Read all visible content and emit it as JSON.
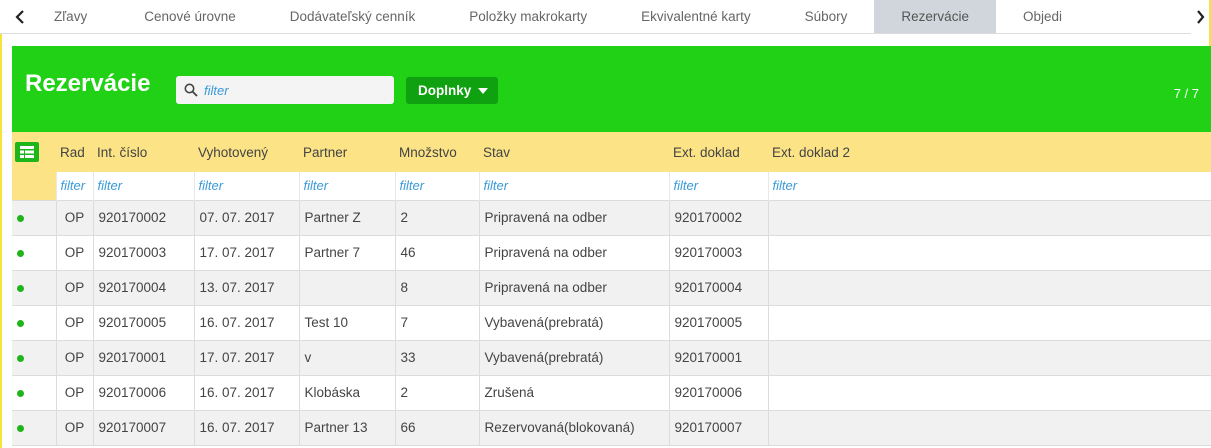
{
  "tabs": [
    {
      "label": "Zľavy",
      "active": false
    },
    {
      "label": "Cenové úrovne",
      "active": false
    },
    {
      "label": "Dodávateľský cenník",
      "active": false
    },
    {
      "label": "Položky makrokarty",
      "active": false
    },
    {
      "label": "Ekvivalentné karty",
      "active": false
    },
    {
      "label": "Súbory",
      "active": false
    },
    {
      "label": "Rezervácie",
      "active": true
    },
    {
      "label": "Objedi",
      "active": false
    }
  ],
  "nav": {
    "prev_icon": "chevron-left-icon",
    "next_icon": "chevron-right-icon"
  },
  "panel": {
    "title": "Rezervácie",
    "search_placeholder": "filter",
    "addons_label": "Doplnky",
    "count": "7 / 7",
    "accent_color": "#21d116",
    "header_color": "#fbe386"
  },
  "columns": [
    "Rad",
    "Int. číslo",
    "Vyhotovený",
    "Partner",
    "Množstvo",
    "Stav",
    "Ext. doklad",
    "Ext. doklad 2"
  ],
  "filter_placeholder": "filter",
  "rows": [
    {
      "rad": "OP",
      "int": "920170002",
      "vyh": "07. 07. 2017",
      "partner": "Partner Z",
      "mnozstvo": "2",
      "stav": "Pripravená na odber",
      "ext": "920170002",
      "ext2": ""
    },
    {
      "rad": "OP",
      "int": "920170003",
      "vyh": "17. 07. 2017",
      "partner": "Partner 7",
      "mnozstvo": "46",
      "stav": "Pripravená na odber",
      "ext": "920170003",
      "ext2": ""
    },
    {
      "rad": "OP",
      "int": "920170004",
      "vyh": "13. 07. 2017",
      "partner": "",
      "mnozstvo": "8",
      "stav": "Pripravená na odber",
      "ext": "920170004",
      "ext2": ""
    },
    {
      "rad": "OP",
      "int": "920170005",
      "vyh": "16. 07. 2017",
      "partner": "Test 10",
      "mnozstvo": "7",
      "stav": "Vybavená(prebratá)",
      "ext": "920170005",
      "ext2": ""
    },
    {
      "rad": "OP",
      "int": "920170001",
      "vyh": "17. 07. 2017",
      "partner": "v",
      "mnozstvo": "33",
      "stav": "Vybavená(prebratá)",
      "ext": "920170001",
      "ext2": ""
    },
    {
      "rad": "OP",
      "int": "920170006",
      "vyh": "16. 07. 2017",
      "partner": "Klobáska",
      "mnozstvo": "2",
      "stav": "Zrušená",
      "ext": "920170006",
      "ext2": ""
    },
    {
      "rad": "OP",
      "int": "920170007",
      "vyh": "16. 07. 2017",
      "partner": "Partner 13",
      "mnozstvo": "66",
      "stav": "Rezervovaná(blokovaná)",
      "ext": "920170007",
      "ext2": ""
    }
  ]
}
